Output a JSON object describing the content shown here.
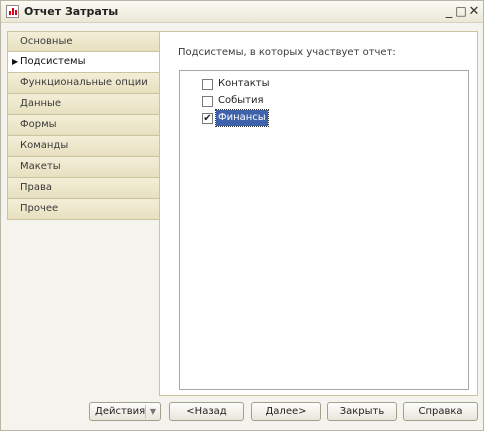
{
  "window": {
    "title": "Отчет Затраты"
  },
  "nav": {
    "items": [
      {
        "label": "Основные"
      },
      {
        "label": "Подсистемы",
        "active": true
      },
      {
        "label": "Функциональные опции"
      },
      {
        "label": "Данные"
      },
      {
        "label": "Формы"
      },
      {
        "label": "Команды"
      },
      {
        "label": "Макеты"
      },
      {
        "label": "Права"
      },
      {
        "label": "Прочее"
      }
    ]
  },
  "panel": {
    "caption": "Подсистемы, в которых участвует отчет:",
    "subsystems": [
      {
        "label": "Контакты",
        "checked": false
      },
      {
        "label": "События",
        "checked": false
      },
      {
        "label": "Финансы",
        "checked": true,
        "selected": true
      }
    ]
  },
  "buttons": {
    "actions": "Действия",
    "back": "<Назад",
    "next": "Далее>",
    "close": "Закрыть",
    "help": "Справка"
  },
  "colors": {
    "accent": "#3e62ab",
    "nav_bg": "#ece6cc",
    "window_bg": "#f4f3ee"
  }
}
